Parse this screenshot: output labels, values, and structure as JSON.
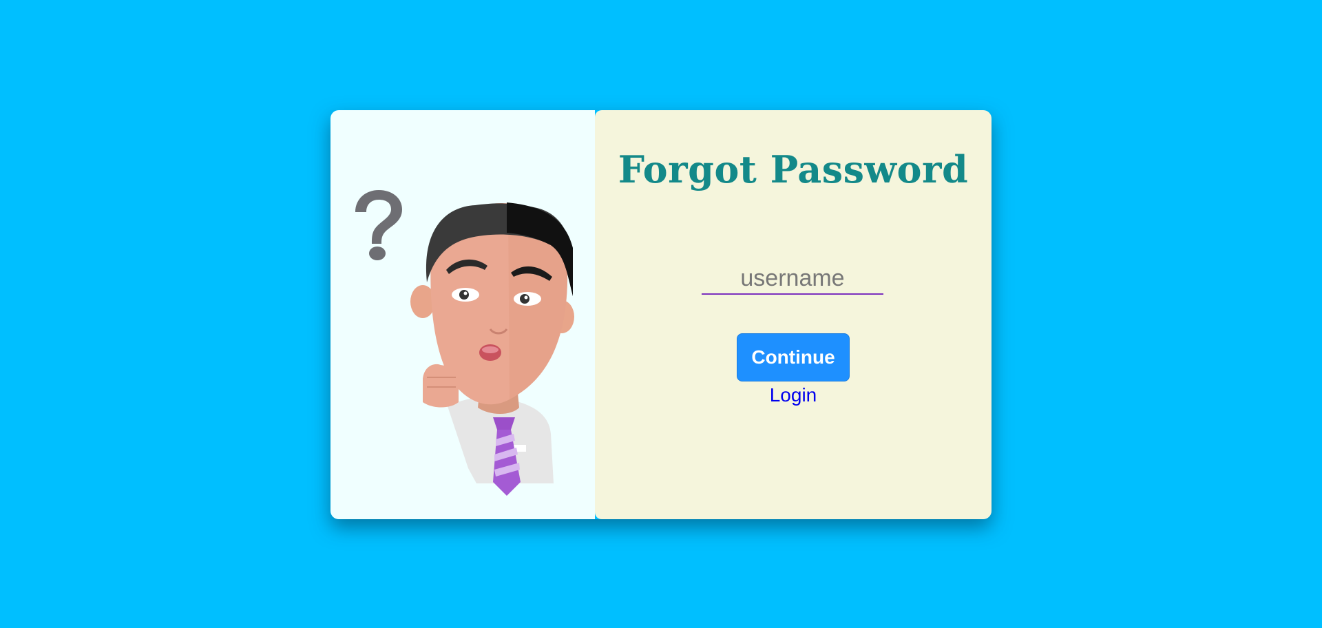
{
  "page": {
    "background_color": "#00BFFF"
  },
  "card": {
    "left_panel_color": "#F0FFFF",
    "right_panel_color": "#F5F5DC"
  },
  "illustration": {
    "icon": "confused-man-question-mark"
  },
  "form": {
    "title": "Forgot Password",
    "title_color": "#138989",
    "username_placeholder": "username",
    "username_value": "",
    "continue_label": "Continue",
    "continue_color": "#1E90FF",
    "login_label": "Login",
    "login_color": "#0000EE"
  }
}
